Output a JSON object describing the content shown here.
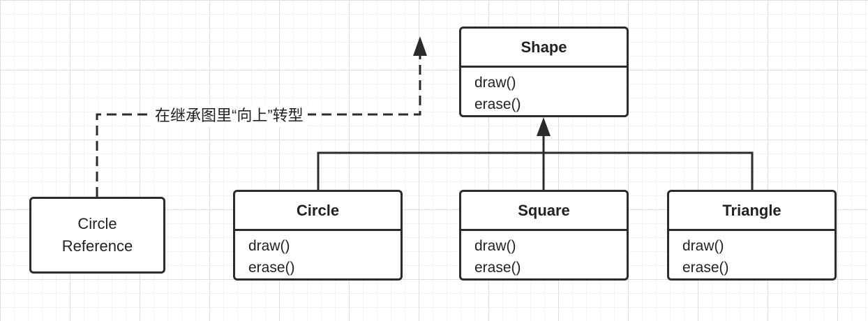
{
  "shape": {
    "title": "Shape",
    "methods": [
      "draw()",
      "erase()"
    ]
  },
  "subclasses": [
    {
      "title": "Circle",
      "methods": [
        "draw()",
        "erase()"
      ]
    },
    {
      "title": "Square",
      "methods": [
        "draw()",
        "erase()"
      ]
    },
    {
      "title": "Triangle",
      "methods": [
        "draw()",
        "erase()"
      ]
    }
  ],
  "reference": {
    "lines": [
      "Circle",
      "Reference"
    ]
  },
  "upcast_label": "在继承图里“向上”转型",
  "colors": {
    "line": "#2b2b2b",
    "grid_major": "#dedede",
    "grid_minor": "#f2f2f2",
    "background": "#ffffff"
  }
}
